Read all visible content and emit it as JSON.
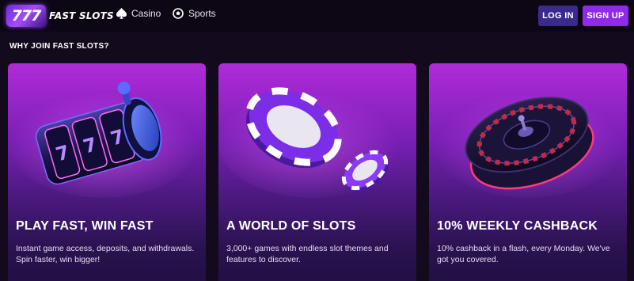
{
  "header": {
    "logo_mark": "777",
    "logo_text": "FAST SLOTS",
    "nav": [
      {
        "label": "Casino",
        "icon": "spade-icon"
      },
      {
        "label": "Sports",
        "icon": "soccer-ball-icon"
      }
    ],
    "login_label": "LOG IN",
    "signup_label": "SIGN UP"
  },
  "section": {
    "title": "WHY JOIN FAST SLOTS?"
  },
  "cards": [
    {
      "title": "PLAY FAST, WIN FAST",
      "description": "Instant game access, deposits, and withdrawals. Spin faster, win bigger!",
      "art": "slot-machine-reel-illustration",
      "reel_symbols": [
        "7",
        "7",
        "7"
      ]
    },
    {
      "title": "A WORLD OF SLOTS",
      "description": "3,000+ games with endless slot themes and features to discover.",
      "art": "casino-chips-illustration"
    },
    {
      "title": "10% WEEKLY CASHBACK",
      "description": "10% cashback in a flash, every Monday. We've got you covered.",
      "art": "roulette-wheel-illustration"
    }
  ],
  "colors": {
    "background": "#130b1d",
    "header": "#0d0715",
    "login_button": "#3b2a8e",
    "signup_button": "#8f2be8",
    "card_top": "#b02bd9",
    "card_bottom": "#221044"
  }
}
